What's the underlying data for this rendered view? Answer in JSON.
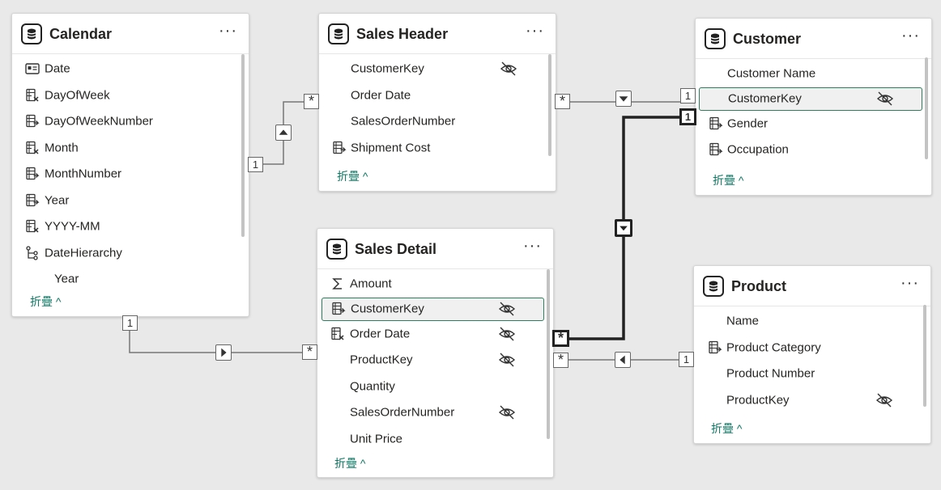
{
  "collapse_label": "折疊 ^",
  "tables": {
    "calendar": {
      "title": "Calendar",
      "more": "···",
      "fields": [
        {
          "name": "Date",
          "icon": "calendar-field-icon"
        },
        {
          "name": "DayOfWeek",
          "icon": "calculated-column-icon"
        },
        {
          "name": "DayOfWeekNumber",
          "icon": "column-icon"
        },
        {
          "name": "Month",
          "icon": "calculated-column-icon"
        },
        {
          "name": "MonthNumber",
          "icon": "column-icon"
        },
        {
          "name": "Year",
          "icon": "column-icon"
        },
        {
          "name": "YYYY-MM",
          "icon": "calculated-column-icon"
        },
        {
          "name": "DateHierarchy",
          "icon": "hierarchy-icon"
        },
        {
          "name": "Year",
          "icon": "none"
        }
      ]
    },
    "sales_header": {
      "title": "Sales Header",
      "more": "···",
      "fields": [
        {
          "name": "CustomerKey",
          "icon": "none",
          "hidden": true
        },
        {
          "name": "Order Date",
          "icon": "none"
        },
        {
          "name": "SalesOrderNumber",
          "icon": "none"
        },
        {
          "name": "Shipment Cost",
          "icon": "column-icon"
        }
      ]
    },
    "customer": {
      "title": "Customer",
      "more": "···",
      "fields": [
        {
          "name": "Customer Name",
          "icon": "none"
        },
        {
          "name": "CustomerKey",
          "icon": "none",
          "hidden": true,
          "selected": true
        },
        {
          "name": "Gender",
          "icon": "column-icon"
        },
        {
          "name": "Occupation",
          "icon": "column-icon"
        }
      ]
    },
    "sales_detail": {
      "title": "Sales Detail",
      "more": "···",
      "fields": [
        {
          "name": "Amount",
          "icon": "sigma-icon"
        },
        {
          "name": "CustomerKey",
          "icon": "column-icon",
          "hidden": true,
          "selected": true
        },
        {
          "name": "Order Date",
          "icon": "calculated-column-icon",
          "hidden": true
        },
        {
          "name": "ProductKey",
          "icon": "none",
          "hidden": true
        },
        {
          "name": "Quantity",
          "icon": "none"
        },
        {
          "name": "SalesOrderNumber",
          "icon": "none",
          "hidden": true
        },
        {
          "name": "Unit Price",
          "icon": "none"
        }
      ]
    },
    "product": {
      "title": "Product",
      "more": "···",
      "fields": [
        {
          "name": "Name",
          "icon": "none"
        },
        {
          "name": "Product Category",
          "icon": "column-icon"
        },
        {
          "name": "Product Number",
          "icon": "none"
        },
        {
          "name": "ProductKey",
          "icon": "none",
          "hidden": true
        }
      ]
    }
  },
  "cardinality": {
    "one": "1",
    "many": "*"
  }
}
